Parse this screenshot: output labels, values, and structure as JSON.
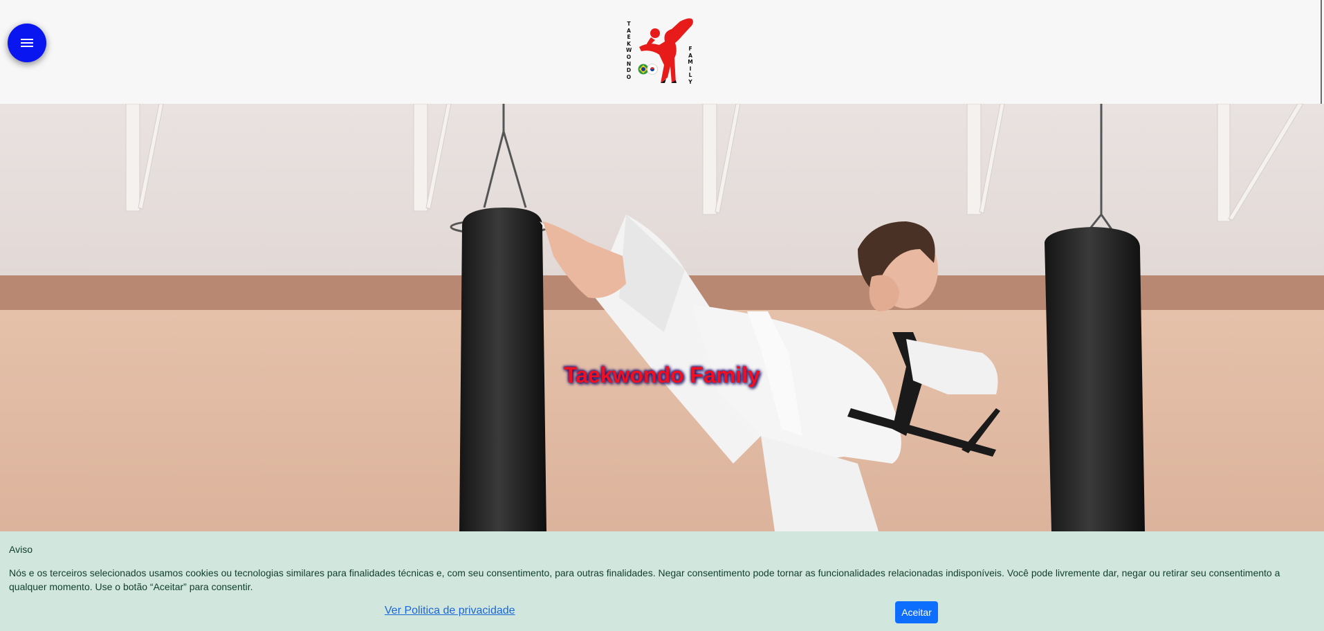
{
  "header": {
    "menu_icon": "hamburger-menu-icon",
    "logo": {
      "left_text": "TAEKWONDO",
      "right_text": "FAMILY",
      "icon": "kicking-fighter-logo",
      "flags": [
        "brazil-flag",
        "south-korea-flag"
      ]
    }
  },
  "hero": {
    "title": "Taekwondo Family",
    "image": "taekwondo-athlete-high-kick-photo",
    "title_color": "#f01020"
  },
  "cookie_banner": {
    "title": "Aviso",
    "text": "Nós e os terceiros selecionados usamos cookies ou tecnologias similares para finalidades técnicas e, com seu consentimento, para outras finalidades. Negar consentimento pode tornar as funcionalidades relacionadas indisponíveis. Você pode livremente dar, negar ou retirar seu consentimento a qualquer momento. Use o botão “Aceitar” para consentir.",
    "privacy_link": "Ver Politica de privacidade",
    "accept_label": "Aceitar",
    "background_color": "#d1e7dd",
    "accent_color": "#0d6efd"
  },
  "colors": {
    "menu_button": "#0a16f0",
    "header_background": "#f7f7f7"
  }
}
